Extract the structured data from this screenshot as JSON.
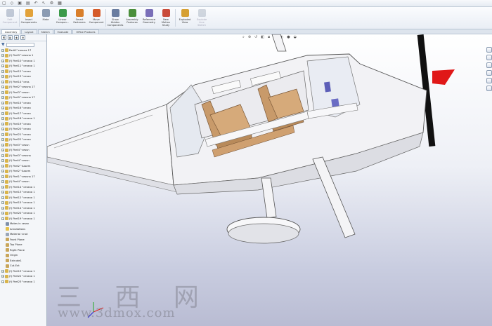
{
  "ribbon": {
    "buttons": [
      {
        "label": "Edit\nComponent",
        "color": "#7f8fa8",
        "disabled": true
      },
      {
        "label": "Insert\nComponents",
        "color": "#e2a23a"
      },
      {
        "label": "Mate",
        "color": "#8b9bb2"
      },
      {
        "label": "Linear\nCompon...",
        "color": "#3c9a4a"
      },
      {
        "label": "Smart\nFasteners",
        "color": "#d97f2b"
      },
      {
        "label": "Move\nComponent",
        "color": "#d55b2a"
      },
      {
        "label": "Show\nHidden\nComponents",
        "color": "#6a7da0"
      },
      {
        "label": "Assembly\nFeatures",
        "color": "#4b8f3c"
      },
      {
        "label": "Reference\nGeometry",
        "color": "#7a6fb8"
      },
      {
        "label": "New\nMotion\nStudy",
        "color": "#c94b3a"
      },
      {
        "label": "Exploded\nView",
        "color": "#d6a033"
      },
      {
        "label": "Explode\nLine\nSketch",
        "color": "#a0aabb",
        "disabled": true
      }
    ]
  },
  "tabs": [
    "Assembly",
    "Layout",
    "Sketch",
    "Evaluate",
    "Office Products"
  ],
  "tree": {
    "rows": [
      {
        "label": "Part8^cessna 17",
        "color": "#d9b44a"
      },
      {
        "label": "(f) Part9^cessna 1",
        "color": "#d9b44a"
      },
      {
        "label": "(f) Part10^cessna 1",
        "color": "#d9b44a"
      },
      {
        "label": "(f) Part11^cessna 1",
        "color": "#d9b44a"
      },
      {
        "label": "(f) Part12^cessn",
        "color": "#d9b44a"
      },
      {
        "label": "(f) Part13^cessn",
        "color": "#d9b44a"
      },
      {
        "label": "(f) Part14^cess",
        "color": "#d9b44a"
      },
      {
        "label": "(f) Part2^cessna 17",
        "color": "#d9b44a"
      },
      {
        "label": "(f) Part3^cessn",
        "color": "#d9b44a"
      },
      {
        "label": "(f) Part9^cessna 17",
        "color": "#d9b44a"
      },
      {
        "label": "(f) Part15^cessn",
        "color": "#d9b44a"
      },
      {
        "label": "(f) Part16^cessn",
        "color": "#d9b44a"
      },
      {
        "label": "(f) Part17^cessn",
        "color": "#d9b44a"
      },
      {
        "label": "(f) Part18^cessna 1",
        "color": "#d9b44a"
      },
      {
        "label": "(f) Part19^cessn",
        "color": "#d9b44a"
      },
      {
        "label": "(f) Part20^cessn",
        "color": "#d9b44a"
      },
      {
        "label": "(f) Part21^cessn",
        "color": "#d9b44a"
      },
      {
        "label": "(f) Part22^cessn",
        "color": "#d9b44a"
      },
      {
        "label": "(f) Part3^cessn",
        "color": "#d9b44a"
      },
      {
        "label": "(f) Part4^cessn",
        "color": "#d9b44a"
      },
      {
        "label": "(f) Part3^cessna",
        "color": "#d9b44a"
      },
      {
        "label": "(f) Part4^cessn",
        "color": "#d9b44a"
      },
      {
        "label": "(f) Part2^Assem",
        "color": "#d9b44a"
      },
      {
        "label": "(f) Part2^Assem",
        "color": "#d9b44a"
      },
      {
        "label": "(f) Part1^cessna 17",
        "color": "#d9b44a"
      },
      {
        "label": "(f) Part4^cessn",
        "color": "#d9b44a"
      },
      {
        "label": "(f) Part14^cessna 1",
        "color": "#d9b44a"
      },
      {
        "label": "(f) Part13^cessna 1",
        "color": "#d9b44a"
      },
      {
        "label": "(f) Part12^cessna 1",
        "color": "#d9b44a"
      },
      {
        "label": "(f) Part15^cessna 1",
        "color": "#d9b44a"
      },
      {
        "label": "(f) Part14^cessna 1",
        "color": "#d9b44a"
      },
      {
        "label": "(f) Part20^cessna 1",
        "color": "#d9b44a"
      },
      {
        "label": "(f) Part19^cessna 1",
        "color": "#d9b44a"
      },
      {
        "label": "Mates in cessn",
        "color": "#7f8fa8",
        "sub": true
      },
      {
        "label": "Annotations",
        "color": "#e6c14a",
        "sub": true
      },
      {
        "label": "Material <not",
        "color": "#9aa6b8",
        "sub": true
      },
      {
        "label": "Front Plane",
        "color": "#c9a65a",
        "sub": true
      },
      {
        "label": "Top Plane",
        "color": "#c9a65a",
        "sub": true
      },
      {
        "label": "Right Plane",
        "color": "#c9a65a",
        "sub": true
      },
      {
        "label": "Origin",
        "color": "#c9a65a",
        "sub": true
      },
      {
        "label": "Extrude1",
        "color": "#c9a65a",
        "sub": true
      },
      {
        "label": "Cut-Ext",
        "color": "#c9a65a",
        "sub": true
      },
      {
        "label": "(f) Part19^cessna 1",
        "color": "#d9b44a"
      },
      {
        "label": "(f) Part22^cessna 1",
        "color": "#d9b44a"
      },
      {
        "label": "(f) Part23^cessna 1",
        "color": "#d9b44a"
      }
    ]
  },
  "watermark": {
    "text": "三 西 网",
    "url": "www.3dmox.com"
  }
}
